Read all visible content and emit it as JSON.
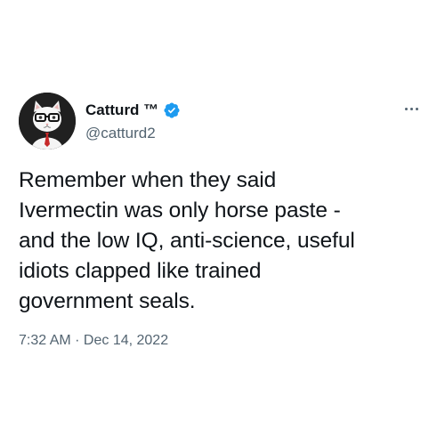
{
  "author": {
    "display_name": "Catturd ™",
    "handle": "@catturd2",
    "verified": true,
    "verified_color": "#1d9bf0",
    "avatar_icon": "cat-with-glasses-avatar"
  },
  "tweet": {
    "text": "Remember when they said\nIvermectin was only horse paste -\nand the low IQ, anti-science, useful\nidiots clapped like trained\ngovernment seals.",
    "time": "7:32 AM",
    "separator": " · ",
    "date": "Dec 14, 2022"
  },
  "colors": {
    "text_primary": "#0f1419",
    "text_secondary": "#536471",
    "background": "#ffffff"
  },
  "menu": {
    "icon": "more-horizontal-icon"
  }
}
